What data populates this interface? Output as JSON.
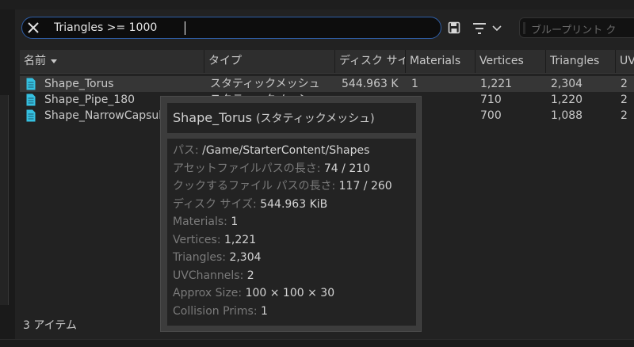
{
  "search": {
    "query": "Triangles >= 1000"
  },
  "toolbar": {
    "blueprint_placeholder": "ブループリント ク"
  },
  "columns": [
    {
      "label": "名前",
      "sorted": true
    },
    {
      "label": "タイプ"
    },
    {
      "label": "ディスク サイ"
    },
    {
      "label": "Materials"
    },
    {
      "label": "Vertices"
    },
    {
      "label": "Triangles"
    },
    {
      "label": "UV"
    }
  ],
  "rows": [
    {
      "name": "Shape_Torus",
      "type": "スタティックメッシュ",
      "disk": "544.963 K",
      "materials": "1",
      "vertices": "1,221",
      "triangles": "2,304",
      "uv": "2",
      "selected": true
    },
    {
      "name": "Shape_Pipe_180",
      "type": "スタティックメッシュ",
      "disk": "",
      "materials": "",
      "vertices": "710",
      "triangles": "1,220",
      "uv": "2"
    },
    {
      "name": "Shape_NarrowCapsule",
      "type": "",
      "disk": "",
      "materials": "",
      "vertices": "700",
      "triangles": "1,088",
      "uv": "2"
    }
  ],
  "status": {
    "item_count": "3 アイテム"
  },
  "tooltip": {
    "title": "Shape_Torus",
    "subtitle": "(スタティックメッシュ)",
    "lines": [
      {
        "key": "パス: ",
        "value": "/Game/StarterContent/Shapes"
      },
      {
        "key": "アセットファイルパスの長さ: ",
        "value": "74 / 210"
      },
      {
        "key": "クックするファイル パスの長さ: ",
        "value": "117 / 260"
      },
      {
        "key": "ディスク サイズ: ",
        "value": "544.963 KiB"
      },
      {
        "key": "Materials: ",
        "value": "1"
      },
      {
        "key": "Vertices: ",
        "value": "1,221"
      },
      {
        "key": "Triangles: ",
        "value": "2,304"
      },
      {
        "key": "UVChannels: ",
        "value": "2"
      },
      {
        "key": "Approx Size: ",
        "value": "100 × 100 × 30"
      },
      {
        "key": "Collision Prims: ",
        "value": "1"
      }
    ]
  },
  "colors": {
    "accent": "#2f5fa8",
    "file_icon": "#35c0e0"
  }
}
